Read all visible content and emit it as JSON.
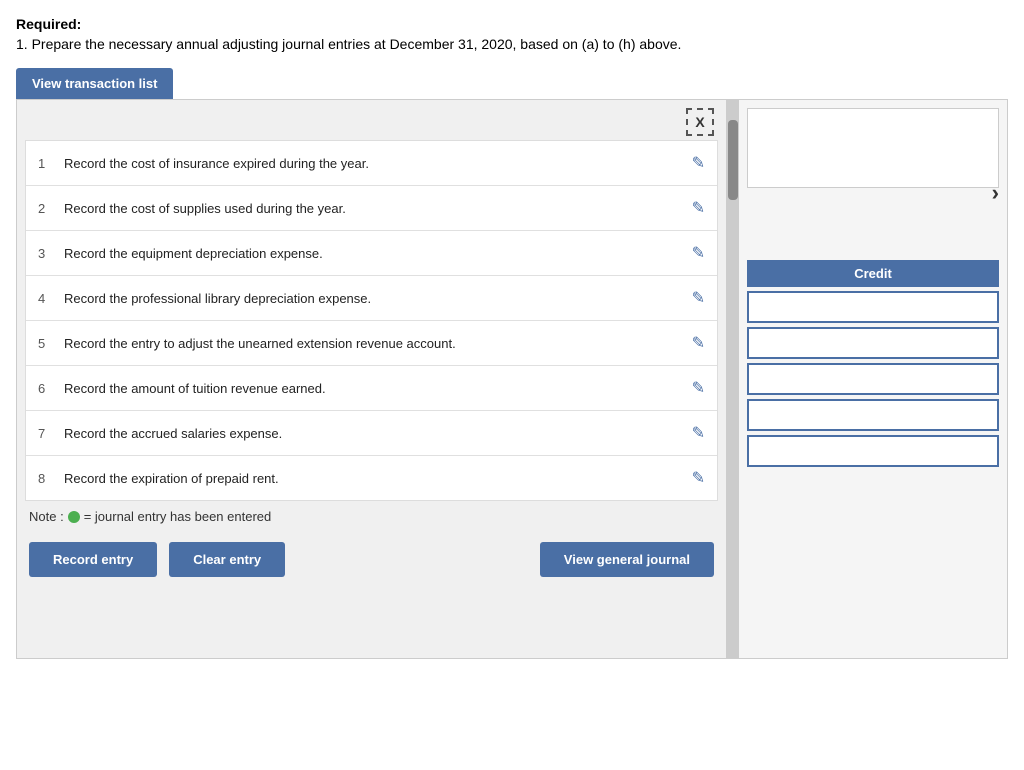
{
  "header": {
    "required_label": "Required:",
    "description": "1. Prepare the necessary annual adjusting journal entries at December 31, 2020, based on (a) to (h) above."
  },
  "view_transaction_btn": "View transaction list",
  "close_btn_label": "X",
  "transactions": [
    {
      "num": "1",
      "text": "Record the cost of insurance expired during the year."
    },
    {
      "num": "2",
      "text": "Record the cost of supplies used during the year."
    },
    {
      "num": "3",
      "text": "Record the equipment depreciation expense."
    },
    {
      "num": "4",
      "text": "Record the professional library depreciation expense."
    },
    {
      "num": "5",
      "text": "Record the entry to adjust the unearned extension revenue account."
    },
    {
      "num": "6",
      "text": "Record the amount of tuition revenue earned."
    },
    {
      "num": "7",
      "text": "Record the accrued salaries expense."
    },
    {
      "num": "8",
      "text": "Record the expiration of prepaid rent."
    }
  ],
  "note_text": "= journal entry has been entered",
  "note_prefix": "Note :",
  "buttons": {
    "record_entry": "Record entry",
    "clear_entry": "Clear entry",
    "view_general_journal": "View general journal"
  },
  "right_panel": {
    "nav_arrow": "›",
    "credit_header": "Credit"
  }
}
